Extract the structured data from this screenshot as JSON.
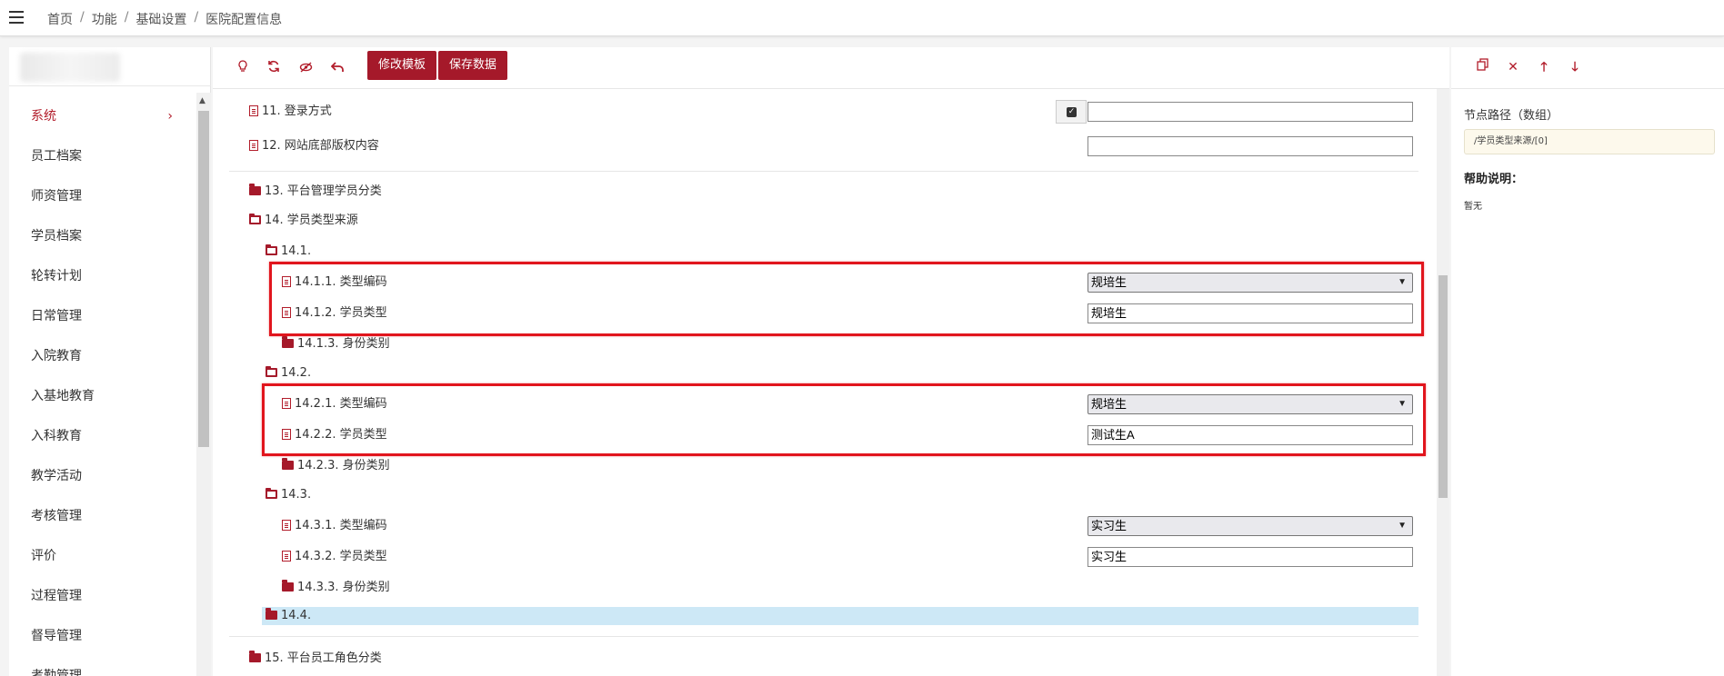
{
  "breadcrumb": [
    "首页",
    "功能",
    "基础设置",
    "医院配置信息"
  ],
  "sidebar": {
    "items": [
      {
        "label": "系统",
        "active": true
      },
      {
        "label": "员工档案"
      },
      {
        "label": "师资管理"
      },
      {
        "label": "学员档案"
      },
      {
        "label": "轮转计划"
      },
      {
        "label": "日常管理"
      },
      {
        "label": "入院教育"
      },
      {
        "label": "入基地教育"
      },
      {
        "label": "入科教育"
      },
      {
        "label": "教学活动"
      },
      {
        "label": "考核管理"
      },
      {
        "label": "评价"
      },
      {
        "label": "过程管理"
      },
      {
        "label": "督导管理"
      },
      {
        "label": "考勤管理"
      }
    ],
    "active_chevron": "›"
  },
  "toolbar": {
    "icons": [
      "lightbulb-icon",
      "refresh-icon",
      "eye-slash-icon",
      "undo-icon"
    ],
    "edit_template_label": "修改模板",
    "save_data_label": "保存数据"
  },
  "tree": {
    "n11": "11. 登录方式",
    "n12": "12. 网站底部版权内容",
    "n13": "13. 平台管理学员分类",
    "n14": "14. 学员类型来源",
    "n14_1": "14.1.",
    "n14_1_1": "14.1.1. 类型编码",
    "n14_1_1_value": "规培生",
    "n14_1_2": "14.1.2. 学员类型",
    "n14_1_2_value": "规培生",
    "n14_1_3": "14.1.3. 身份类别",
    "n14_2": "14.2.",
    "n14_2_1": "14.2.1. 类型编码",
    "n14_2_1_value": "规培生",
    "n14_2_2": "14.2.2. 学员类型",
    "n14_2_2_value": "测试生A",
    "n14_2_3": "14.2.3. 身份类别",
    "n14_3": "14.3.",
    "n14_3_1": "14.3.1. 类型编码",
    "n14_3_1_value": "实习生",
    "n14_3_2": "14.3.2. 学员类型",
    "n14_3_2_value": "实习生",
    "n14_3_3": "14.3.3. 身份类别",
    "n14_4": "14.4.",
    "n15": "15. 平台员工角色分类",
    "n11_value": "",
    "n12_value": ""
  },
  "right_panel": {
    "icons": [
      "copy-icon",
      "close-icon",
      "arrow-up-icon",
      "arrow-down-icon"
    ],
    "node_path_label": "节点路径（数组）",
    "node_path_value": "/学员类型来源/[0]",
    "help_label": "帮助说明：",
    "help_text": "暂无"
  },
  "colors": {
    "accent": "#a5192a",
    "highlight_box": "#e1151d",
    "selected_row": "#cde8f6"
  }
}
